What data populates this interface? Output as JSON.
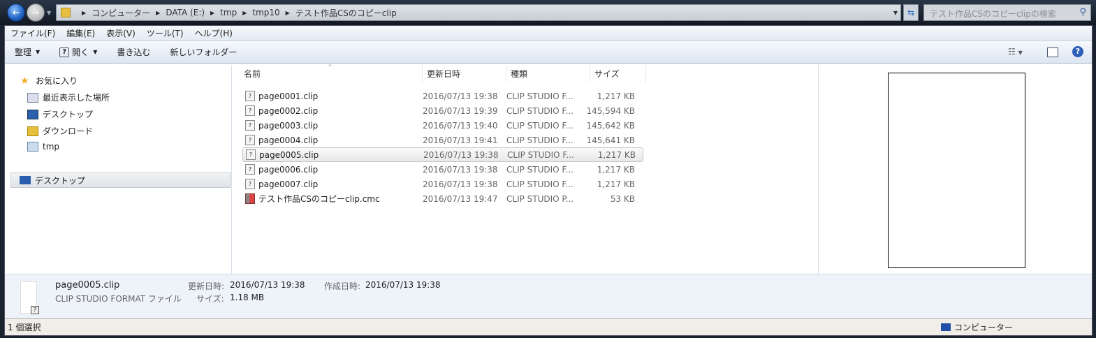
{
  "address": {
    "crumbs": [
      "コンピューター",
      "DATA (E:)",
      "tmp",
      "tmp10",
      "テスト作品CSのコピーclip"
    ],
    "search_placeholder": "テスト作品CSのコピーclipの検索"
  },
  "menu": [
    "ファイル(F)",
    "編集(E)",
    "表示(V)",
    "ツール(T)",
    "ヘルプ(H)"
  ],
  "toolbar": {
    "organize": "整理",
    "open": "開く",
    "burn": "書き込む",
    "new_folder": "新しいフォルダー"
  },
  "nav": {
    "favorites": "お気に入り",
    "items": [
      "最近表示した場所",
      "デスクトップ",
      "ダウンロード",
      "tmp"
    ],
    "desktop": "デスクトップ"
  },
  "columns": [
    "名前",
    "更新日時",
    "種類",
    "サイズ"
  ],
  "files": [
    {
      "name": "page0001.clip",
      "date": "2016/07/13 19:38",
      "type": "CLIP STUDIO F...",
      "size": "1,217 KB"
    },
    {
      "name": "page0002.clip",
      "date": "2016/07/13 19:39",
      "type": "CLIP STUDIO F...",
      "size": "145,594 KB"
    },
    {
      "name": "page0003.clip",
      "date": "2016/07/13 19:40",
      "type": "CLIP STUDIO F...",
      "size": "145,642 KB"
    },
    {
      "name": "page0004.clip",
      "date": "2016/07/13 19:41",
      "type": "CLIP STUDIO F...",
      "size": "145,641 KB"
    },
    {
      "name": "page0005.clip",
      "date": "2016/07/13 19:38",
      "type": "CLIP STUDIO F...",
      "size": "1,217 KB"
    },
    {
      "name": "page0006.clip",
      "date": "2016/07/13 19:38",
      "type": "CLIP STUDIO F...",
      "size": "1,217 KB"
    },
    {
      "name": "page0007.clip",
      "date": "2016/07/13 19:38",
      "type": "CLIP STUDIO F...",
      "size": "1,217 KB"
    },
    {
      "name": "テスト作品CSのコピーclip.cmc",
      "date": "2016/07/13 19:47",
      "type": "CLIP STUDIO P...",
      "size": "53 KB"
    }
  ],
  "details": {
    "name": "page0005.clip",
    "type": "CLIP STUDIO FORMAT ファイル",
    "modified_label": "更新日時:",
    "modified": "2016/07/13 19:38",
    "created_label": "作成日時:",
    "created": "2016/07/13 19:38",
    "size_label": "サイズ:",
    "size": "1.18 MB"
  },
  "status": {
    "selected": "1 個選択",
    "location": "コンピューター"
  }
}
